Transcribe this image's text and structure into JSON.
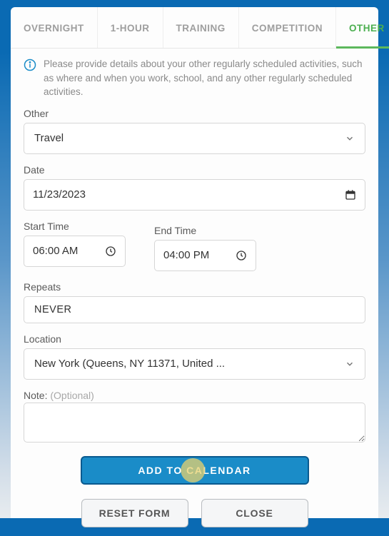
{
  "tabs": {
    "overnight": "OVERNIGHT",
    "one_hour": "1-HOUR",
    "training": "TRAINING",
    "competition": "COMPETITION",
    "other": "OTHER"
  },
  "info_text": "Please provide details about your other regularly scheduled activities, such as where and when you work, school, and any other regularly scheduled activities.",
  "labels": {
    "other": "Other",
    "date": "Date",
    "start_time": "Start Time",
    "end_time": "End Time",
    "repeats": "Repeats",
    "location": "Location",
    "note": "Note: ",
    "note_optional": "(Optional)"
  },
  "values": {
    "other_category": "Travel",
    "date": "11/23/2023",
    "start_time": "06:00 AM",
    "end_time": "04:00 PM",
    "repeats": "NEVER",
    "location": "New York (Queens, NY 11371, United ...",
    "note": ""
  },
  "buttons": {
    "add": "ADD TO CALENDAR",
    "reset": "RESET FORM",
    "close": "CLOSE"
  }
}
